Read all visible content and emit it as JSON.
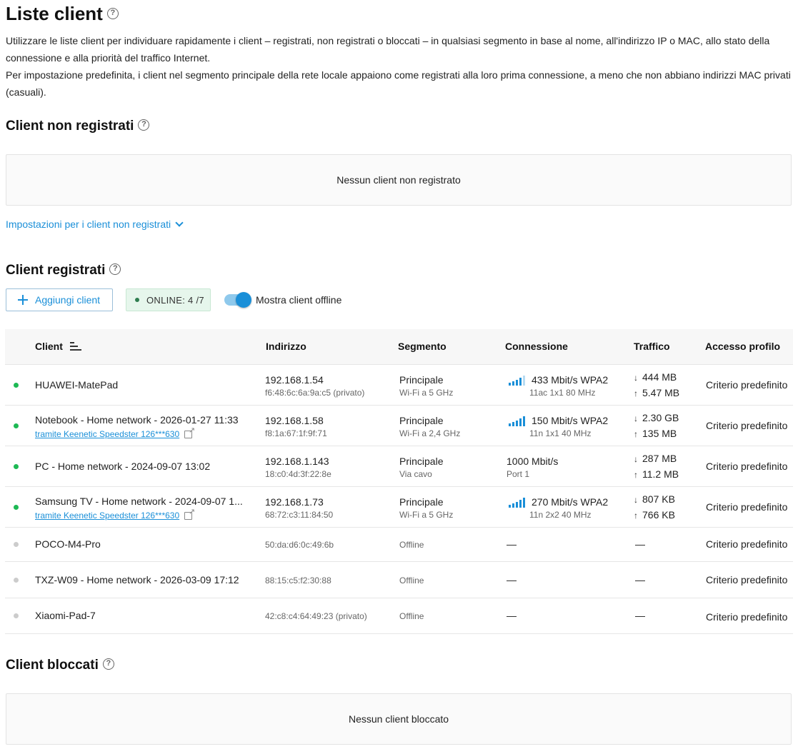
{
  "page": {
    "title": "Liste client",
    "desc_line1": "Utilizzare le liste client per individuare rapidamente i client – registrati, non registrati o bloccati – in qualsiasi segmento in base al nome, all'indirizzo IP o MAC, allo stato della connessione e alla priorità del traffico Internet.",
    "desc_line2": "Per impostazione predefinita, i client nel segmento principale della rete locale appaiono come registrati alla loro prima connessione, a meno che non abbiano indirizzi MAC privati (casuali)."
  },
  "help_glyph": "?",
  "unregistered": {
    "title": "Client non registrati",
    "empty_text": "Nessun client non registrato",
    "settings_link": "Impostazioni per i client non registrati"
  },
  "registered": {
    "title": "Client registrati",
    "add_button": "Aggiungi client",
    "online_badge": "ONLINE: 4 /7",
    "toggle_label": "Mostra client offline",
    "toggle_on": true,
    "headers": {
      "client": "Client",
      "address": "Indirizzo",
      "segment": "Segmento",
      "connection": "Connessione",
      "traffic": "Traffico",
      "profile": "Accesso profilo"
    },
    "rows": [
      {
        "online": true,
        "name": "HUAWEI-MatePad",
        "via": "",
        "ip": "192.168.1.54",
        "mac": "f6:48:6c:6a:9a:c5 (privato)",
        "segment": "Principale",
        "segment_sub": "Wi-Fi a 5 GHz",
        "conn_wifi": true,
        "conn_main": "433 Mbit/s  WPA2",
        "conn_sub": "11ac 1x1 80 MHz",
        "rx": "444 MB",
        "tx": "5.47 MB",
        "profile": "Criterio predefinito"
      },
      {
        "online": true,
        "name": "Notebook - Home network - 2026-01-27 11:33",
        "via": "tramite Keenetic Speedster 126***630",
        "ip": "192.168.1.58",
        "mac": "f8:1a:67:1f:9f:71",
        "segment": "Principale",
        "segment_sub": "Wi-Fi a 2,4 GHz",
        "conn_wifi": true,
        "conn_main": "150 Mbit/s  WPA2",
        "conn_sub": "11n 1x1 40 MHz",
        "rx": "2.30 GB",
        "tx": "135 MB",
        "profile": "Criterio predefinito"
      },
      {
        "online": true,
        "name": "PC - Home network - 2024-09-07 13:02",
        "via": "",
        "ip": "192.168.1.143",
        "mac": "18:c0:4d:3f:22:8e",
        "segment": "Principale",
        "segment_sub": "Via cavo",
        "conn_wifi": false,
        "conn_main": "1000 Mbit/s",
        "conn_sub": "Port 1",
        "rx": "287 MB",
        "tx": "11.2 MB",
        "profile": "Criterio predefinito"
      },
      {
        "online": true,
        "name": "Samsung TV - Home network - 2024-09-07 1...",
        "via": "tramite Keenetic Speedster 126***630",
        "ip": "192.168.1.73",
        "mac": "68:72:c3:11:84:50",
        "segment": "Principale",
        "segment_sub": "Wi-Fi a 5 GHz",
        "conn_wifi": true,
        "conn_main": "270 Mbit/s  WPA2",
        "conn_sub": "11n 2x2 40 MHz",
        "rx": "807 KB",
        "tx": "766 KB",
        "profile": "Criterio predefinito"
      },
      {
        "online": false,
        "name": "POCO-M4-Pro",
        "mac": "50:da:d6:0c:49:6b",
        "segment": "Offline",
        "conn": "—",
        "traffic": "—",
        "profile": "Criterio predefinito"
      },
      {
        "online": false,
        "name": "TXZ-W09 - Home network - 2026-03-09 17:12",
        "mac": "88:15:c5:f2:30:88",
        "segment": "Offline",
        "conn": "—",
        "traffic": "—",
        "profile": "Criterio predefinito"
      },
      {
        "online": false,
        "name": "Xiaomi-Pad-7",
        "mac": "42:c8:c4:64:49:23 (privato)",
        "segment": "Offline",
        "conn": "—",
        "traffic": "—",
        "profile": "Criterio predefinito"
      }
    ]
  },
  "blocked": {
    "title": "Client bloccati",
    "empty_text": "Nessun client bloccato"
  },
  "icons": {
    "download_arrow": "↓",
    "upload_arrow": "↑"
  },
  "colors": {
    "accent": "#1a8fd8",
    "online_dot": "#1db954",
    "offline_dot": "#cccccc"
  }
}
